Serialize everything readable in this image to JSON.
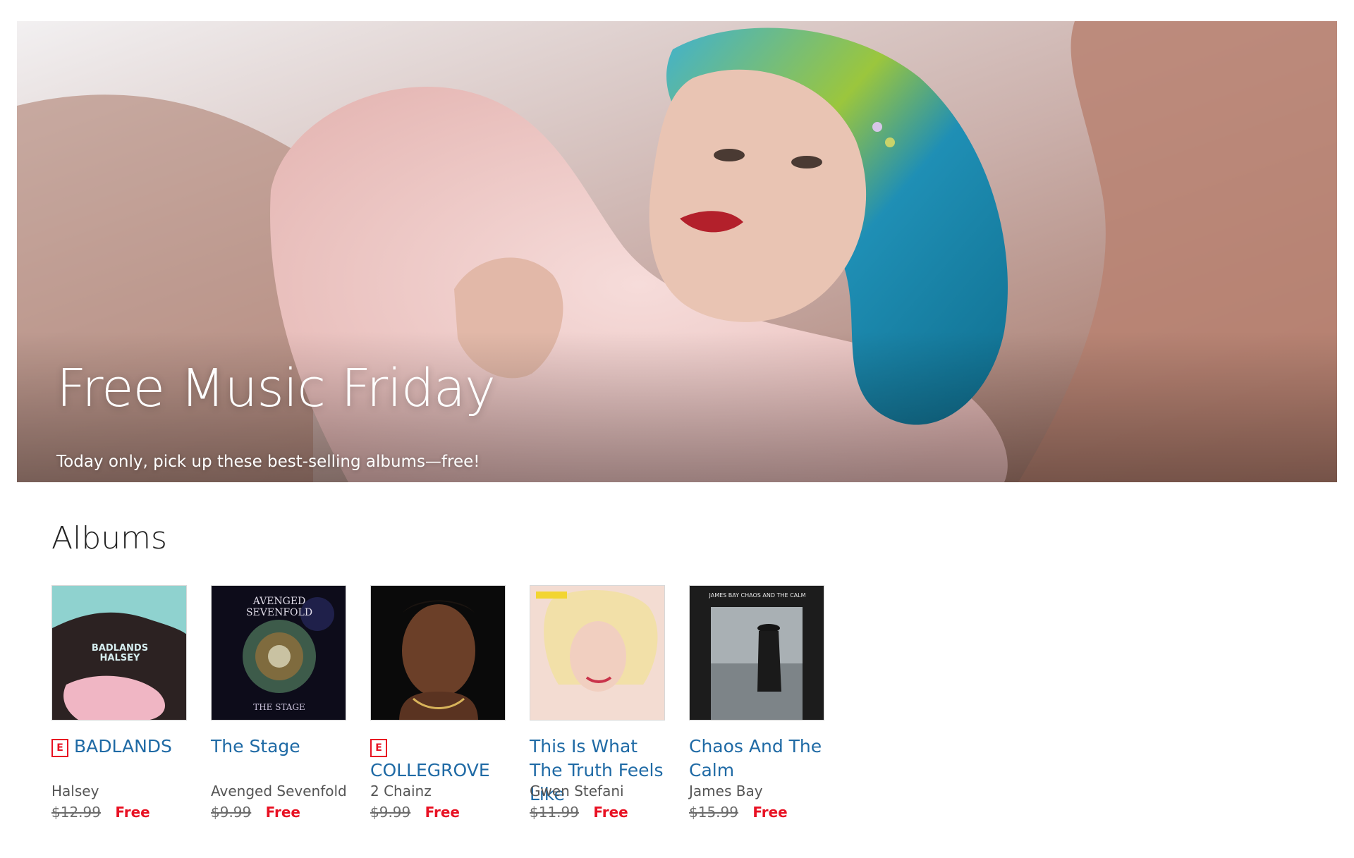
{
  "hero": {
    "title": "Free Music Friday",
    "subtitle": "Today only, pick up these best-selling albums—free!"
  },
  "albums_section": {
    "title": "Albums",
    "items": [
      {
        "title": "BADLANDS",
        "artist": "Halsey",
        "price": "$12.99",
        "offer": "Free",
        "explicit": "E",
        "cover_text": [
          "BADLANDS",
          "HALSEY"
        ]
      },
      {
        "title": "The Stage",
        "artist": "Avenged Sevenfold",
        "price": "$9.99",
        "offer": "Free",
        "cover_text": [
          "AVENGED",
          "SEVENFOLD",
          "THE STAGE"
        ]
      },
      {
        "title": "COLLEGROVE",
        "artist": "2 Chainz",
        "price": "$9.99",
        "offer": "Free",
        "explicit": "E"
      },
      {
        "title": "This Is What The Truth Feels Like",
        "artist": "Gwen Stefani",
        "price": "$11.99",
        "offer": "Free"
      },
      {
        "title": "Chaos And The Calm",
        "artist": "James Bay",
        "price": "$15.99",
        "offer": "Free",
        "cover_text": [
          "JAMES BAY  CHAOS AND THE CALM"
        ]
      }
    ]
  },
  "colors": {
    "link": "#1f6aa5",
    "free": "#e81123",
    "explicit": "#e81123"
  }
}
